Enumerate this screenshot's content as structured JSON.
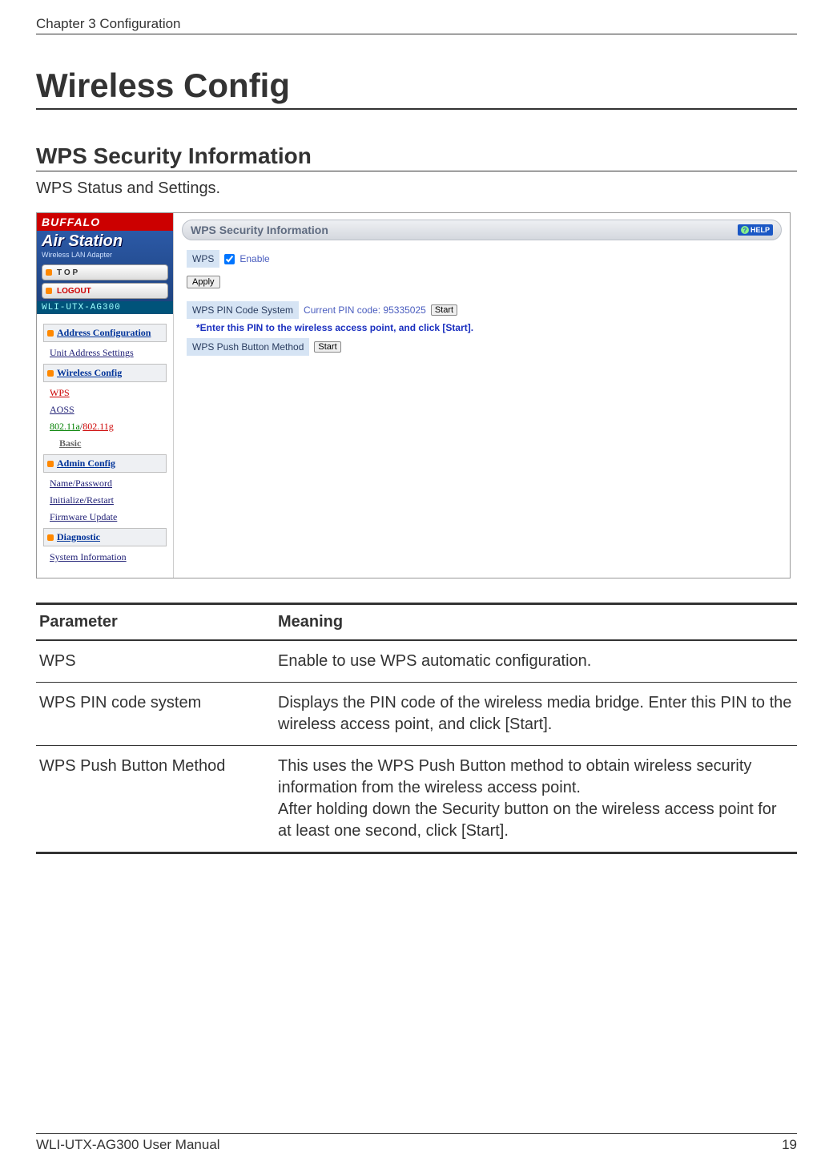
{
  "header": {
    "chapter": "Chapter 3  Configuration"
  },
  "titles": {
    "main": "Wireless Config",
    "sub": "WPS Security Information",
    "intro": "WPS Status and Settings."
  },
  "screenshot": {
    "logo_brand": "BUFFALO",
    "logo_product": "Air Station",
    "logo_sub": "Wireless LAN Adapter",
    "nav_top": "T O P",
    "nav_logout": "LOGOUT",
    "model": "WLI-UTX-AG300",
    "side": {
      "addr_conf": "Address Configuration",
      "unit_addr": "Unit Address Settings",
      "wireless_conf": "Wireless Config",
      "wps": "WPS",
      "aoss": "AOSS",
      "band_a": "802.11a",
      "band_sep": "/",
      "band_g": "802.11g",
      "basic": "Basic",
      "admin_conf": "Admin Config",
      "name_pw": "Name/Password",
      "init_restart": "Initialize/Restart",
      "fw_update": "Firmware Update",
      "diagnostic": "Diagnostic",
      "sys_info": "System Information"
    },
    "panel": {
      "title": "WPS Security Information",
      "help": "HELP",
      "wps_label": "WPS",
      "enable_label": "Enable",
      "apply": "Apply",
      "pin_label": "WPS PIN Code System",
      "pin_text": "Current PIN code: 95335025",
      "start": "Start",
      "hint": "*Enter this PIN to the wireless access point, and click [Start].",
      "push_label": "WPS Push Button Method"
    }
  },
  "table": {
    "head_param": "Parameter",
    "head_meaning": "Meaning",
    "rows": [
      {
        "param": "WPS",
        "meaning": "Enable to use WPS automatic configuration."
      },
      {
        "param": "WPS PIN code system",
        "meaning": "Displays the PIN code of the wireless media bridge. Enter this PIN to the wireless access point, and click [Start]."
      },
      {
        "param": "WPS Push Button Method",
        "meaning": "This uses the WPS Push Button method to obtain wireless security information from the wireless access point.\nAfter holding down the Security button on the wireless access point for at least one second, click [Start]."
      }
    ]
  },
  "footer": {
    "left": "WLI-UTX-AG300 User Manual",
    "right": "19"
  }
}
